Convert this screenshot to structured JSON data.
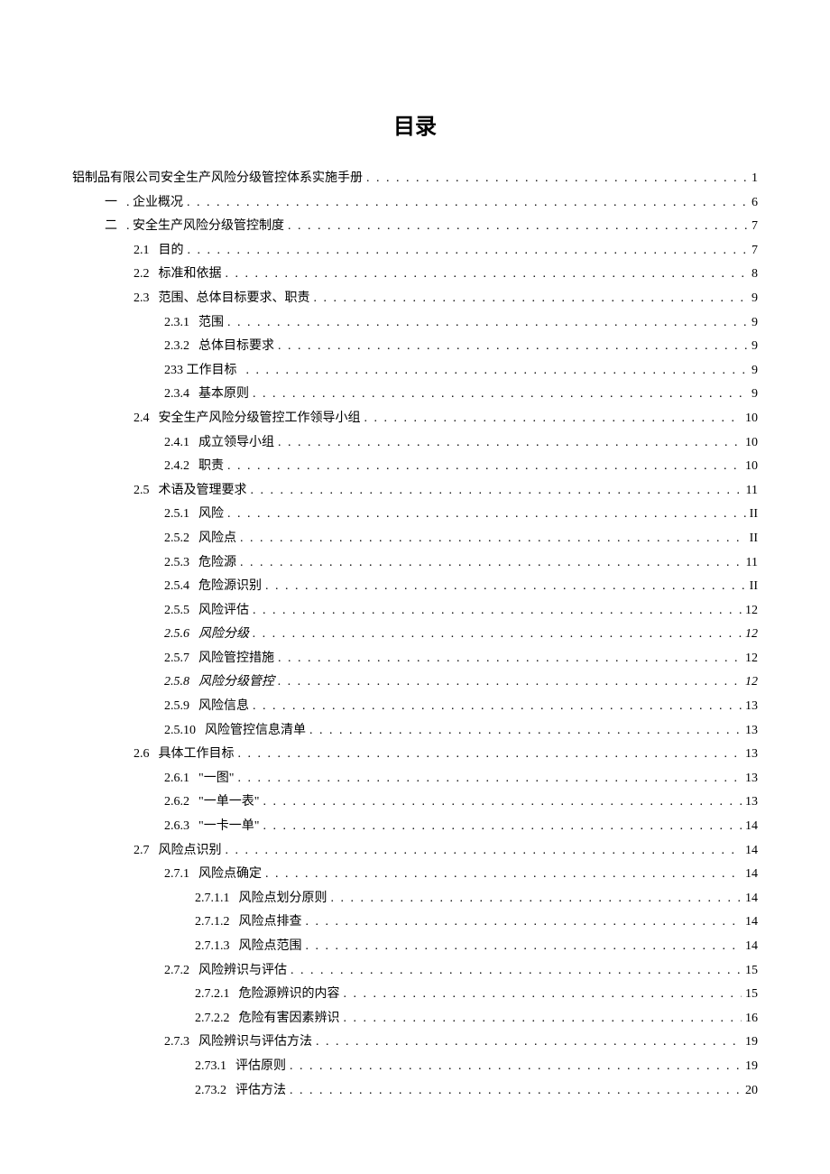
{
  "heading": "目录",
  "toc": [
    {
      "indent": 0,
      "num": "",
      "label": "铝制品有限公司安全生产风险分级管控体系实施手册",
      "page": "1",
      "italic": false
    },
    {
      "indent": 1,
      "num": "一",
      "label": ". 企业概况",
      "page": "6",
      "italic": false
    },
    {
      "indent": 1,
      "num": "二",
      "label": ". 安全生产风险分级管控制度",
      "page": "7",
      "italic": false
    },
    {
      "indent": 2,
      "num": "2.1",
      "label": "目的",
      "page": "7",
      "italic": false
    },
    {
      "indent": 2,
      "num": "2.2",
      "label": "标准和依据",
      "page": "8",
      "italic": false
    },
    {
      "indent": 2,
      "num": "2.3",
      "label": "范围、总体目标要求、职责",
      "page": "9",
      "italic": false
    },
    {
      "indent": 3,
      "num": "2.3.1",
      "label": "范围",
      "page": "9",
      "italic": false
    },
    {
      "indent": 3,
      "num": "2.3.2",
      "label": "总体目标要求",
      "page": "9",
      "italic": false
    },
    {
      "indent": 3,
      "num": "233 工作目标",
      "label": "",
      "page": "9",
      "italic": false
    },
    {
      "indent": 3,
      "num": "2.3.4",
      "label": "基本原则",
      "page": "9",
      "italic": false
    },
    {
      "indent": 2,
      "num": "2.4",
      "label": "安全生产风险分级管控工作领导小组",
      "page": "10",
      "italic": false
    },
    {
      "indent": 3,
      "num": "2.4.1",
      "label": "成立领导小组",
      "page": "10",
      "italic": false
    },
    {
      "indent": 3,
      "num": "2.4.2",
      "label": "职责",
      "page": "10",
      "italic": false
    },
    {
      "indent": 2,
      "num": "2.5",
      "label": "术语及管理要求",
      "page": "11",
      "italic": false
    },
    {
      "indent": 3,
      "num": "2.5.1",
      "label": "风险",
      "page": "II",
      "italic": false
    },
    {
      "indent": 3,
      "num": "2.5.2",
      "label": "风险点",
      "page": "II",
      "italic": false
    },
    {
      "indent": 3,
      "num": "2.5.3",
      "label": "危险源",
      "page": "11",
      "italic": false
    },
    {
      "indent": 3,
      "num": "2.5.4",
      "label": "危险源识别",
      "page": "II",
      "italic": false
    },
    {
      "indent": 3,
      "num": "2.5.5",
      "label": "风险评估",
      "page": "12",
      "italic": false
    },
    {
      "indent": 3,
      "num": "2.5.6",
      "label": "风险分级",
      "page": "12",
      "italic": true
    },
    {
      "indent": 3,
      "num": "2.5.7",
      "label": "风险管控措施",
      "page": "12",
      "italic": false
    },
    {
      "indent": 3,
      "num": "2.5.8",
      "label": "风险分级管控",
      "page": "12",
      "italic": true
    },
    {
      "indent": 3,
      "num": "2.5.9",
      "label": "风险信息",
      "page": "13",
      "italic": false
    },
    {
      "indent": 3,
      "num": "2.5.10",
      "label": "风险管控信息清单",
      "page": "13",
      "italic": false
    },
    {
      "indent": 2,
      "num": "2.6",
      "label": "具体工作目标",
      "page": "13",
      "italic": false
    },
    {
      "indent": 3,
      "num": "2.6.1",
      "label": "\"一图\"",
      "page": "13",
      "italic": false
    },
    {
      "indent": 3,
      "num": "2.6.2",
      "label": "\"一单一表\"",
      "page": "13",
      "italic": false
    },
    {
      "indent": 3,
      "num": "2.6.3",
      "label": "\"一卡一单\"",
      "page": "14",
      "italic": false
    },
    {
      "indent": 2,
      "num": "2.7",
      "label": "风险点识别",
      "page": "14",
      "italic": false
    },
    {
      "indent": 3,
      "num": "2.7.1",
      "label": "风险点确定",
      "page": "14",
      "italic": false
    },
    {
      "indent": 4,
      "num": "2.7.1.1",
      "label": "风险点划分原则",
      "page": "14",
      "italic": false
    },
    {
      "indent": 4,
      "num": "2.7.1.2",
      "label": "风险点排查",
      "page": "14",
      "italic": false
    },
    {
      "indent": 4,
      "num": "2.7.1.3",
      "label": "风险点范围",
      "page": "14",
      "italic": false
    },
    {
      "indent": 3,
      "num": "2.7.2",
      "label": "风险辨识与评估",
      "page": "15",
      "italic": false
    },
    {
      "indent": 4,
      "num": "2.7.2.1",
      "label": "危险源辨识的内容",
      "page": "15",
      "italic": false
    },
    {
      "indent": 4,
      "num": "2.7.2.2",
      "label": "危险有害因素辨识",
      "page": "16",
      "italic": false
    },
    {
      "indent": 3,
      "num": "2.7.3",
      "label": "风险辨识与评估方法",
      "page": "19",
      "italic": false
    },
    {
      "indent": 4,
      "num": "2.73.1",
      "label": "评估原则",
      "page": "19",
      "italic": false
    },
    {
      "indent": 4,
      "num": "2.73.2",
      "label": "评估方法",
      "page": "20",
      "italic": false
    }
  ]
}
